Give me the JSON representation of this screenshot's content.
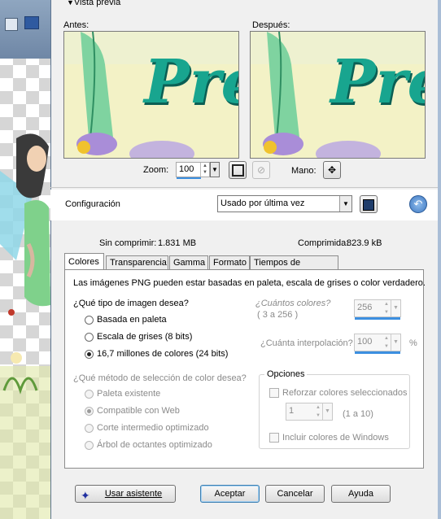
{
  "preview": {
    "header": "Vista previa",
    "before_label": "Antes:",
    "after_label": "Después:",
    "preview_text": "Pre",
    "zoom_label": "Zoom:",
    "zoom_value": "100",
    "hand_label": "Mano:"
  },
  "config": {
    "label": "Configuración",
    "preset": "Usado por última vez"
  },
  "sizes": {
    "uncompressed_label": "Sin comprimir:",
    "uncompressed_value": "1.831 MB",
    "compressed_label": "Comprimida:",
    "compressed_value": "823.9 kB"
  },
  "tabs": [
    "Colores",
    "Transparencia",
    "Gamma",
    "Formato",
    "Tiempos de descarga"
  ],
  "colors_tab": {
    "description": "Las imágenes PNG pueden estar basadas en paleta, escala de grises o color verdadero.",
    "image_type_question": "¿Qué tipo de imagen desea?",
    "image_types": [
      "Basada en paleta",
      "Escala de grises (8 bits)",
      "16,7 millones de colores (24 bits)"
    ],
    "selected_image_type": "16,7 millones de colores (24 bits)",
    "how_many_colors_label": "¿Cuántos colores?",
    "colors_range": "( 3 a 256 )",
    "colors_value": "256",
    "interpolation_label": "¿Cuánta interpolación?",
    "interpolation_value": "100",
    "interpolation_unit": "%",
    "method_question": "¿Qué método de selección de color desea?",
    "methods": [
      "Paleta existente",
      "Compatible con Web",
      "Corte intermedio optimizado",
      "Árbol de octantes optimizado"
    ],
    "selected_method": "Compatible con Web",
    "options_title": "Opciones",
    "reinforce_label": "Reforzar colores seleccionados",
    "reinforce_value": "1",
    "reinforce_range": "(1 a 10)",
    "include_windows_label": "Incluir colores de Windows"
  },
  "buttons": {
    "wizard": "Usar asistente",
    "ok": "Aceptar",
    "cancel": "Cancelar",
    "help": "Ayuda"
  },
  "colors": {
    "accent": "#3c8fe0",
    "dialog_bg": "#f0f0f0",
    "preview_text": "#18a58f"
  }
}
